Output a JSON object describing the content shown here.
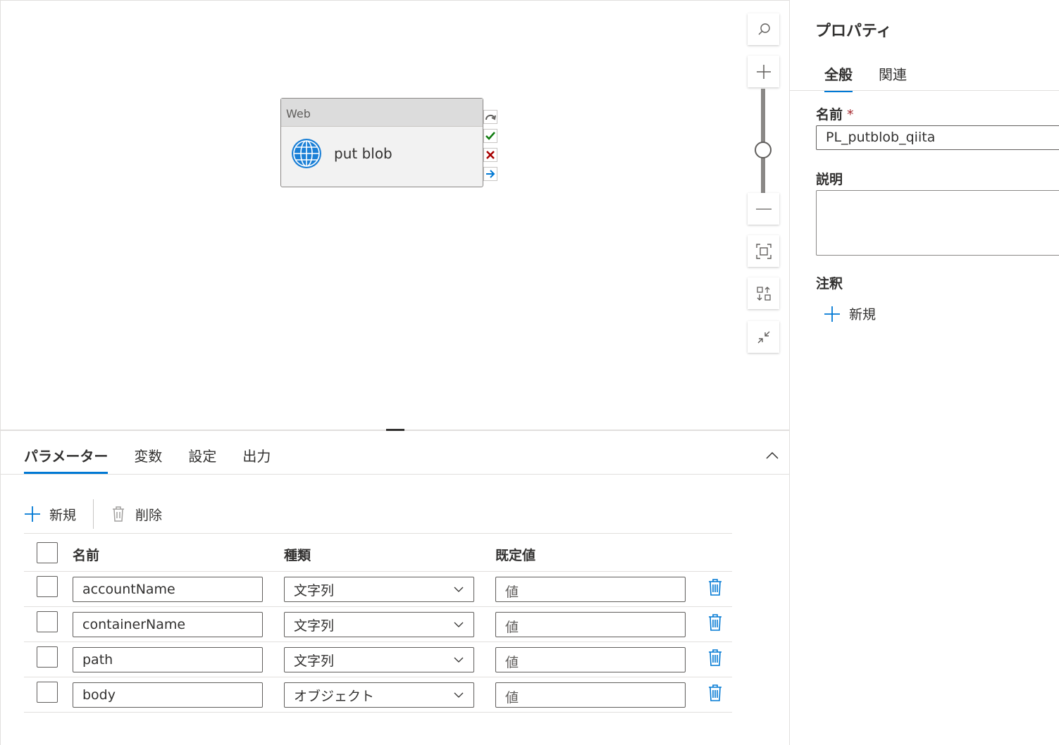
{
  "canvas": {
    "activity": {
      "type_label": "Web",
      "name": "put blob",
      "icon": "globe-icon"
    },
    "connectors": [
      "skip-icon",
      "success-check-icon",
      "failure-x-icon",
      "completion-arrow-icon"
    ],
    "tools": [
      "search-icon",
      "zoom-in-icon",
      "zoom-slider",
      "zoom-out-icon",
      "fit-to-screen-icon",
      "auto-align-icon",
      "collapse-icon"
    ]
  },
  "bottom_panel": {
    "tabs": [
      {
        "label": "パラメーター",
        "active": true
      },
      {
        "label": "変数",
        "active": false
      },
      {
        "label": "設定",
        "active": false
      },
      {
        "label": "出力",
        "active": false
      }
    ],
    "toolbar": {
      "new_label": "新規",
      "delete_label": "削除"
    },
    "table": {
      "columns": [
        "名前",
        "種類",
        "既定値"
      ],
      "rows": [
        {
          "name": "accountName",
          "type": "文字列",
          "default_placeholder": "値"
        },
        {
          "name": "containerName",
          "type": "文字列",
          "default_placeholder": "値"
        },
        {
          "name": "path",
          "type": "文字列",
          "default_placeholder": "値"
        },
        {
          "name": "body",
          "type": "オブジェクト",
          "default_placeholder": "値"
        }
      ]
    }
  },
  "properties": {
    "title": "プロパティ",
    "tabs": [
      {
        "label": "全般",
        "active": true
      },
      {
        "label": "関連",
        "active": false
      }
    ],
    "name_label": "名前",
    "required_marker": "*",
    "name_value": "PL_putblob_qiita",
    "description_label": "説明",
    "description_value": "",
    "annotations_label": "注釈",
    "add_annotation_label": "新規"
  },
  "colors": {
    "accent": "#0078d4",
    "success": "#107c10",
    "failure": "#a80000",
    "required": "#a4262c"
  }
}
